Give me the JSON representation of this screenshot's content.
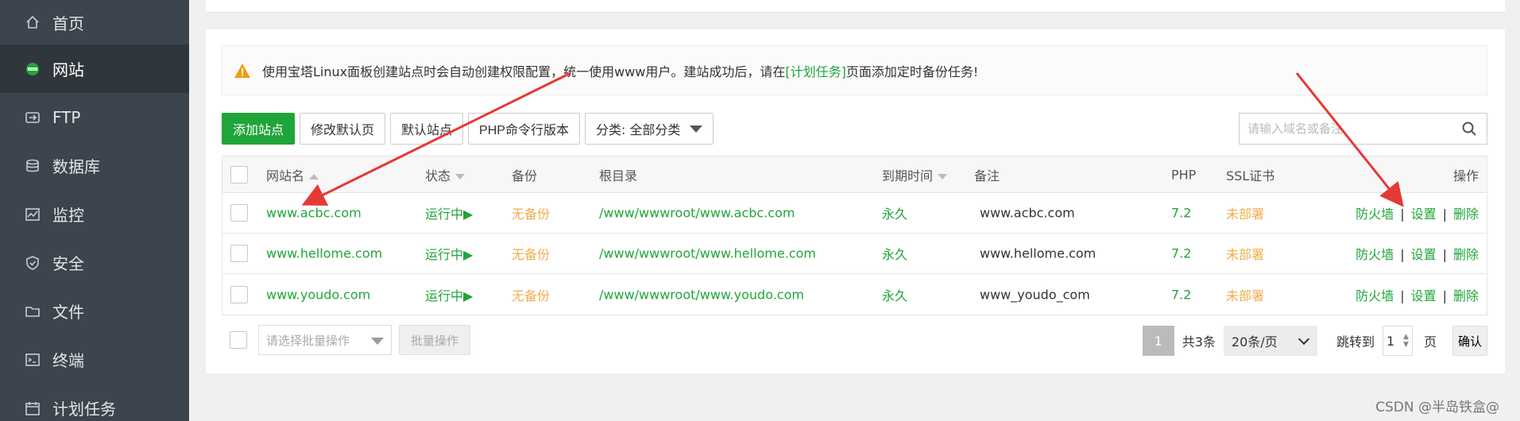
{
  "sidebar": {
    "items": [
      {
        "label": "首页",
        "icon": "home-icon"
      },
      {
        "label": "网站",
        "icon": "globe-icon",
        "active": true
      },
      {
        "label": "FTP",
        "icon": "ftp-icon"
      },
      {
        "label": "数据库",
        "icon": "database-icon"
      },
      {
        "label": "监控",
        "icon": "monitor-icon"
      },
      {
        "label": "安全",
        "icon": "shield-icon"
      },
      {
        "label": "文件",
        "icon": "folder-icon"
      },
      {
        "label": "终端",
        "icon": "terminal-icon"
      },
      {
        "label": "计划任务",
        "icon": "calendar-icon"
      }
    ]
  },
  "notice": {
    "text_before": "使用宝塔Linux面板创建站点时会自动创建权限配置，统一使用www用户。建站成功后，请在",
    "link": "[计划任务]",
    "text_after": "页面添加定时备份任务!"
  },
  "toolbar": {
    "add_site": "添加站点",
    "edit_default_page": "修改默认页",
    "default_site": "默认站点",
    "php_cli_version": "PHP命令行版本",
    "category": "分类: 全部分类"
  },
  "search": {
    "placeholder": "请输入域名或备注"
  },
  "table": {
    "headers": {
      "name": "网站名",
      "status": "状态",
      "backup": "备份",
      "root": "根目录",
      "expire": "到期时间",
      "remark": "备注",
      "php": "PHP",
      "ssl": "SSL证书",
      "actions": "操作"
    },
    "rows": [
      {
        "name": "www.acbc.com",
        "status": "运行中▶",
        "backup": "无备份",
        "root": "/www/wwwroot/www.acbc.com",
        "expire": "永久",
        "remark": "www.acbc.com",
        "php": "7.2",
        "ssl": "未部署",
        "firewall": "防火墙",
        "settings": "设置",
        "delete": "删除"
      },
      {
        "name": "www.hellome.com",
        "status": "运行中▶",
        "backup": "无备份",
        "root": "/www/wwwroot/www.hellome.com",
        "expire": "永久",
        "remark": "www.hellome.com",
        "php": "7.2",
        "ssl": "未部署",
        "firewall": "防火墙",
        "settings": "设置",
        "delete": "删除"
      },
      {
        "name": "www.youdo.com",
        "status": "运行中▶",
        "backup": "无备份",
        "root": "/www/wwwroot/www.youdo.com",
        "expire": "永久",
        "remark": "www_youdo_com",
        "php": "7.2",
        "ssl": "未部署",
        "firewall": "防火墙",
        "settings": "设置",
        "delete": "删除"
      }
    ],
    "separator": "|"
  },
  "footer": {
    "batch_select_placeholder": "请选择批量操作",
    "batch_button": "批量操作",
    "page_current": "1",
    "total": "共3条",
    "page_size": "20条/页",
    "jump_label": "跳转到",
    "jump_value": "1",
    "page_unit": "页",
    "confirm": "确认"
  },
  "watermark": "CSDN @半岛铁盒@",
  "colors": {
    "sidebar_bg": "#3c444d",
    "accent_green": "#20a53a",
    "warning_orange": "#f0ad4e",
    "annotation_red": "#e53935"
  }
}
